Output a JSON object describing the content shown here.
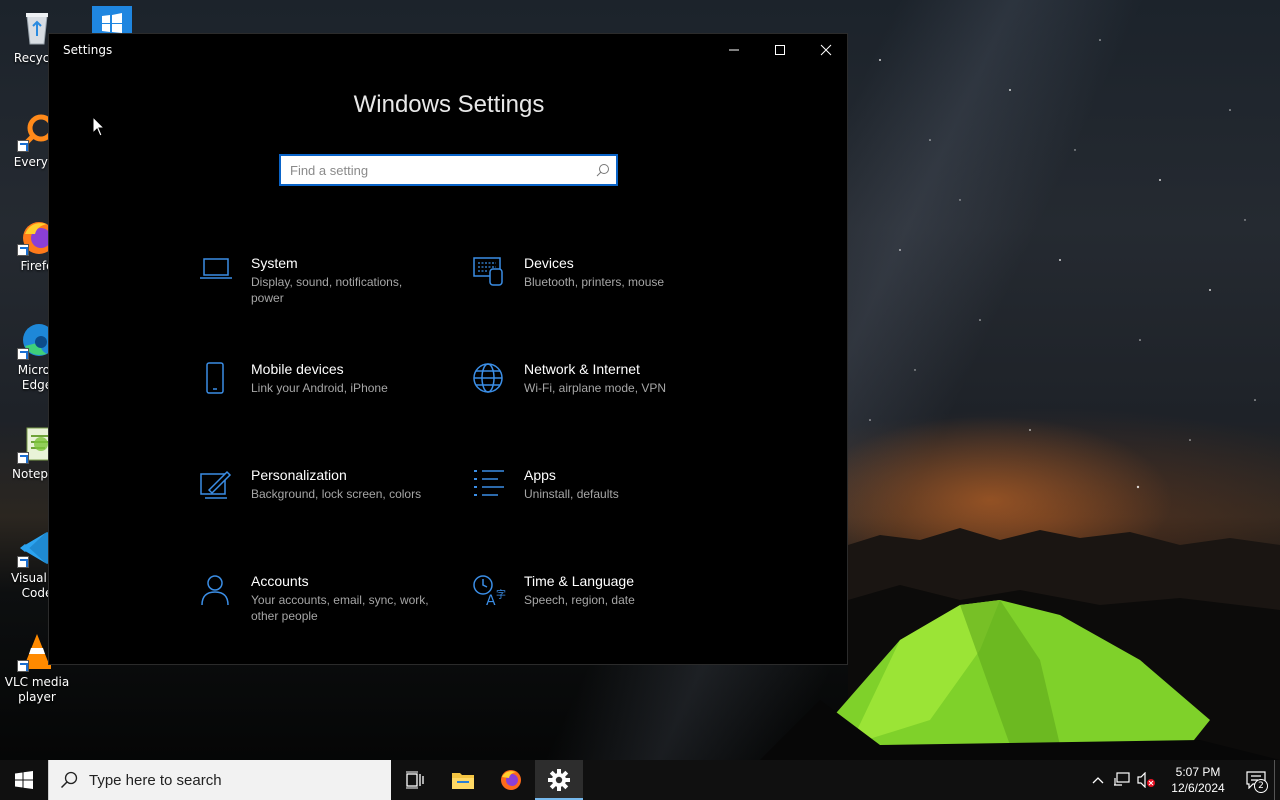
{
  "desktop": {
    "icons": [
      {
        "label": "Recycle",
        "icon": "recycle-bin-icon"
      },
      {
        "label": "Everyth",
        "icon": "everything-search-icon"
      },
      {
        "label": "Firefo",
        "icon": "firefox-icon"
      },
      {
        "label": "Micros\nEdge",
        "label_line1": "Micros",
        "label_line2": "Edge",
        "icon": "edge-icon"
      },
      {
        "label": "Notepac",
        "icon": "notepad-plus-icon"
      },
      {
        "label_line1": "Visual St",
        "label_line2": "Code",
        "icon": "vscode-icon"
      },
      {
        "label_line1": "VLC media",
        "label_line2": "player",
        "icon": "vlc-icon"
      }
    ]
  },
  "window": {
    "title": "Settings",
    "heading": "Windows Settings",
    "search_placeholder": "Find a setting",
    "accent_color": "#0a64c8",
    "icon_color": "#3b8ee6",
    "categories": [
      {
        "title": "System",
        "desc": "Display, sound, notifications, power",
        "icon": "laptop-icon"
      },
      {
        "title": "Devices",
        "desc": "Bluetooth, printers, mouse",
        "icon": "keyboard-devices-icon"
      },
      {
        "title": "Mobile devices",
        "desc": "Link your Android, iPhone",
        "icon": "phone-icon"
      },
      {
        "title": "Network & Internet",
        "desc": "Wi-Fi, airplane mode, VPN",
        "icon": "globe-icon"
      },
      {
        "title": "Personalization",
        "desc": "Background, lock screen, colors",
        "icon": "paint-icon"
      },
      {
        "title": "Apps",
        "desc": "Uninstall, defaults",
        "icon": "apps-list-icon"
      },
      {
        "title": "Accounts",
        "desc": "Your accounts, email, sync, work, other people",
        "icon": "person-icon"
      },
      {
        "title": "Time & Language",
        "desc": "Speech, region, date",
        "icon": "time-language-icon"
      }
    ]
  },
  "taskbar": {
    "search_placeholder": "Type here to search",
    "apps": [
      "task-view-icon",
      "file-explorer-icon",
      "firefox-icon",
      "settings-gear-icon"
    ],
    "active_app": "settings-gear-icon",
    "clock_time": "5:07 PM",
    "clock_date": "12/6/2024",
    "notification_count": "2"
  }
}
